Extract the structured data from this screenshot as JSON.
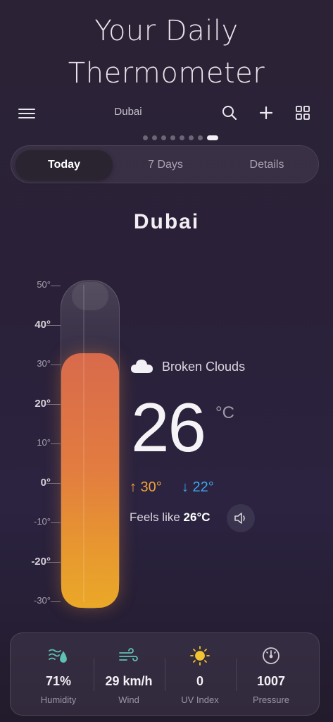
{
  "page_title": "Your Daily Thermometer",
  "header": {
    "city": "Dubai",
    "menu_icon": "menu-icon",
    "search_icon": "search-icon",
    "add_icon": "plus-icon",
    "grid_icon": "grid-icon"
  },
  "pagination": {
    "count": 8,
    "active_index": 7
  },
  "tabs": [
    {
      "label": "Today",
      "active": true
    },
    {
      "label": "7 Days",
      "active": false
    },
    {
      "label": "Details",
      "active": false
    }
  ],
  "city_title": "Dubai",
  "thermometer": {
    "scale_labels": [
      "50°",
      "40°",
      "30°",
      "20°",
      "10°",
      "0°",
      "-10°",
      "-20°",
      "-30°"
    ],
    "current_value": 26,
    "min_value": -30,
    "max_value": 50,
    "fill_colors": [
      "#d86a4c",
      "#eaa828"
    ]
  },
  "weather": {
    "condition_icon": "cloud-icon",
    "condition": "Broken Clouds",
    "temperature": "26",
    "unit": "°C",
    "high": "↑ 30°",
    "low": "↓ 22°",
    "feels_like_label": "Feels like",
    "feels_like_value": "26°C",
    "speaker_icon": "speaker-icon",
    "high_color": "#f0a33b",
    "low_color": "#3fa5ec"
  },
  "stats": [
    {
      "icon": "humidity-icon",
      "value": "71%",
      "label": "Humidity"
    },
    {
      "icon": "wind-icon",
      "value": "29 km/h",
      "label": "Wind"
    },
    {
      "icon": "sun-icon",
      "value": "0",
      "label": "UV Index"
    },
    {
      "icon": "gauge-icon",
      "value": "1007",
      "label": "Pressure"
    }
  ]
}
